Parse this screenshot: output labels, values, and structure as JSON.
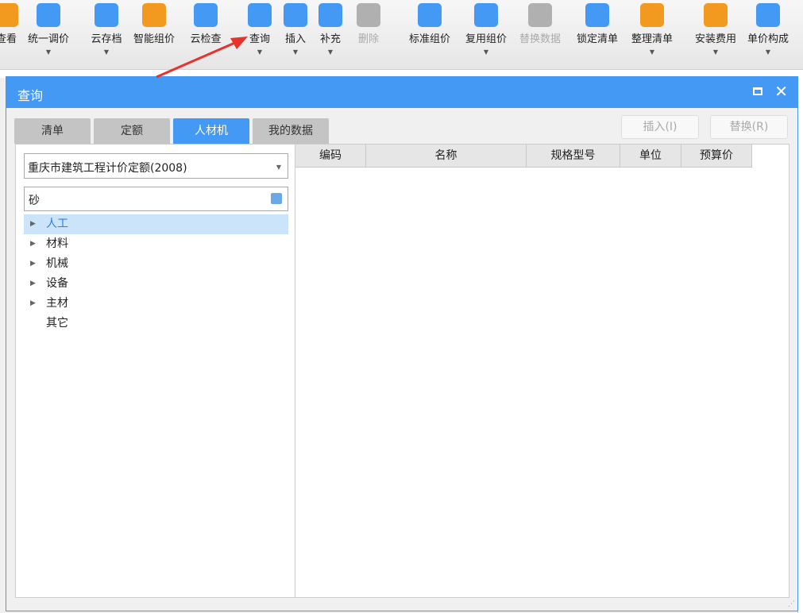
{
  "toolbar": {
    "items": [
      {
        "label": "查看",
        "icon": "view-icon",
        "dropdown": false,
        "disabled": false
      },
      {
        "label": "统一调价",
        "icon": "unified-price-icon",
        "dropdown": true,
        "disabled": false
      },
      {
        "label": "云存档",
        "icon": "cloud-upload-icon",
        "dropdown": true,
        "disabled": false
      },
      {
        "label": "智能组价",
        "icon": "smart-price-icon",
        "dropdown": false,
        "disabled": false
      },
      {
        "label": "云检查",
        "icon": "cloud-check-icon",
        "dropdown": false,
        "disabled": false
      },
      {
        "label": "查询",
        "icon": "query-icon",
        "dropdown": true,
        "disabled": false
      },
      {
        "label": "插入",
        "icon": "insert-icon",
        "dropdown": true,
        "disabled": false
      },
      {
        "label": "补充",
        "icon": "supplement-icon",
        "dropdown": true,
        "disabled": false
      },
      {
        "label": "删除",
        "icon": "trash-icon",
        "dropdown": false,
        "disabled": true
      },
      {
        "label": "标准组价",
        "icon": "standard-price-icon",
        "dropdown": false,
        "disabled": false
      },
      {
        "label": "复用组价",
        "icon": "reuse-price-icon",
        "dropdown": true,
        "disabled": false
      },
      {
        "label": "替换数据",
        "icon": "replace-data-icon",
        "dropdown": false,
        "disabled": true
      },
      {
        "label": "锁定清单",
        "icon": "lock-icon",
        "dropdown": false,
        "disabled": false
      },
      {
        "label": "整理清单",
        "icon": "organize-list-icon",
        "dropdown": true,
        "disabled": false
      },
      {
        "label": "安装费用",
        "icon": "install-fee-icon",
        "dropdown": true,
        "disabled": false
      },
      {
        "label": "单价构成",
        "icon": "unit-price-icon",
        "dropdown": true,
        "disabled": false
      }
    ]
  },
  "colors": {
    "accent": "#4499f5",
    "selected_row": "#cce4fa",
    "arrow": "#e8322c"
  },
  "dialog": {
    "title": "查询",
    "tabs": [
      {
        "label": "清单"
      },
      {
        "label": "定额"
      },
      {
        "label": "人材机",
        "active": true
      },
      {
        "label": "我的数据"
      }
    ],
    "insert_label": "插入(I)",
    "replace_label": "替换(R)",
    "quota_select": "重庆市建筑工程计价定额(2008)",
    "search_value": "砂",
    "tree": [
      {
        "label": "人工",
        "expandable": true,
        "selected": true
      },
      {
        "label": "材料",
        "expandable": true
      },
      {
        "label": "机械",
        "expandable": true
      },
      {
        "label": "设备",
        "expandable": true
      },
      {
        "label": "主材",
        "expandable": true
      },
      {
        "label": "其它",
        "expandable": false
      }
    ],
    "columns": [
      "编码",
      "名称",
      "规格型号",
      "单位",
      "预算价"
    ]
  }
}
